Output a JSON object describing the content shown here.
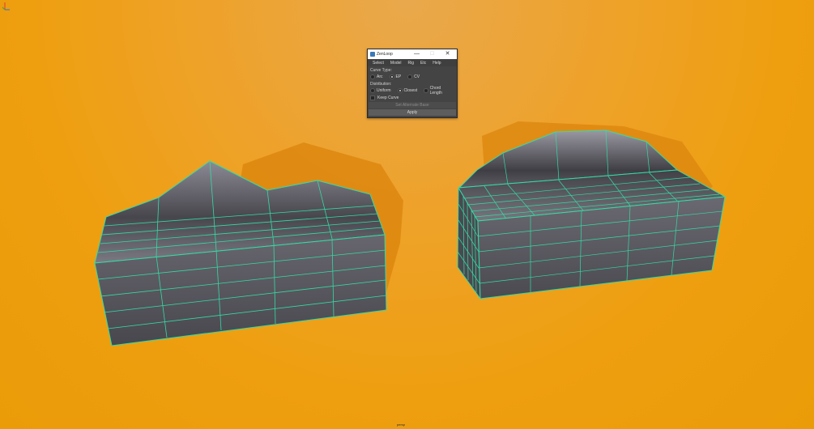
{
  "window": {
    "title": "ZenLoop",
    "controls": {
      "minimize": "—",
      "maximize": "□",
      "close": "✕"
    }
  },
  "menu": [
    "Select",
    "Model",
    "Rig",
    "Etc",
    "Help"
  ],
  "curve_type": {
    "label": "Curve Type:",
    "options": [
      "Arc",
      "EP",
      "CV"
    ],
    "selected": "EP"
  },
  "distribution": {
    "label": "Distribution:",
    "options": [
      "Uniform",
      "Closest",
      "Chord Length"
    ],
    "selected": "Closest"
  },
  "keep_curve": {
    "label": "Keep Curve",
    "checked": false
  },
  "buttons": {
    "set_alternate": "Set Alternate Base",
    "apply": "Apply"
  },
  "viewport": {
    "camera_label": "persp",
    "background_color": "#ee9f10",
    "wire_color": "#34dba5",
    "mesh_color": "#58575e",
    "shadow_color": "#d9840e"
  },
  "icons": {
    "window_icon": "app-icon",
    "axis_gizmo": "axis-icon"
  }
}
